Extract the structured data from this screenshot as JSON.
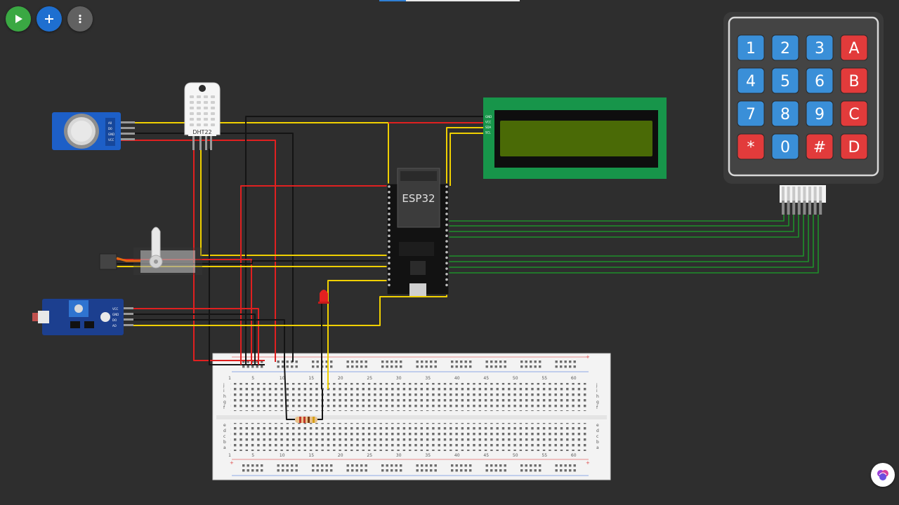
{
  "toolbar": {
    "run_icon": "play-icon",
    "add_icon": "plus-icon",
    "more_icon": "vertical-dots-icon",
    "run_color": "#3aa843",
    "add_color": "#1e6fd0",
    "more_color": "#616161"
  },
  "keypad": {
    "keys": [
      "1",
      "2",
      "3",
      "A",
      "4",
      "5",
      "6",
      "B",
      "7",
      "8",
      "9",
      "C",
      "*",
      "0",
      "#",
      "D"
    ],
    "digit_color": "#3a8fd8",
    "letter_color": "#e23b3b"
  },
  "esp32": {
    "label": "ESP32"
  },
  "dht22": {
    "label": "DHT22"
  },
  "lcd": {
    "pins": [
      "GND",
      "VCC",
      "SDA",
      "SCL"
    ]
  },
  "breadboard": {
    "column_numbers_top": [
      "1",
      "5",
      "10",
      "15",
      "20",
      "25",
      "30",
      "35",
      "40",
      "45",
      "50",
      "55",
      "60"
    ],
    "column_numbers_bottom": [
      "1",
      "5",
      "10",
      "15",
      "20",
      "25",
      "30",
      "35",
      "40",
      "45",
      "50",
      "55",
      "60"
    ],
    "row_letters_top": [
      "j",
      "i",
      "h",
      "g",
      "f"
    ],
    "row_letters_bottom": [
      "e",
      "d",
      "c",
      "b",
      "a"
    ],
    "plus_sign": "+"
  },
  "gas_sensor": {
    "pins": [
      "A0",
      "D0",
      "GND",
      "VCC"
    ]
  },
  "ldr_sensor": {
    "pins": [
      "VCC",
      "GND",
      "DO",
      "AO"
    ]
  },
  "wire_colors": {
    "red": "#e02020",
    "black": "#141414",
    "yellow": "#f0d000",
    "green": "#1e8f2a"
  },
  "assistant": {
    "icon": "ai-brain-icon"
  }
}
